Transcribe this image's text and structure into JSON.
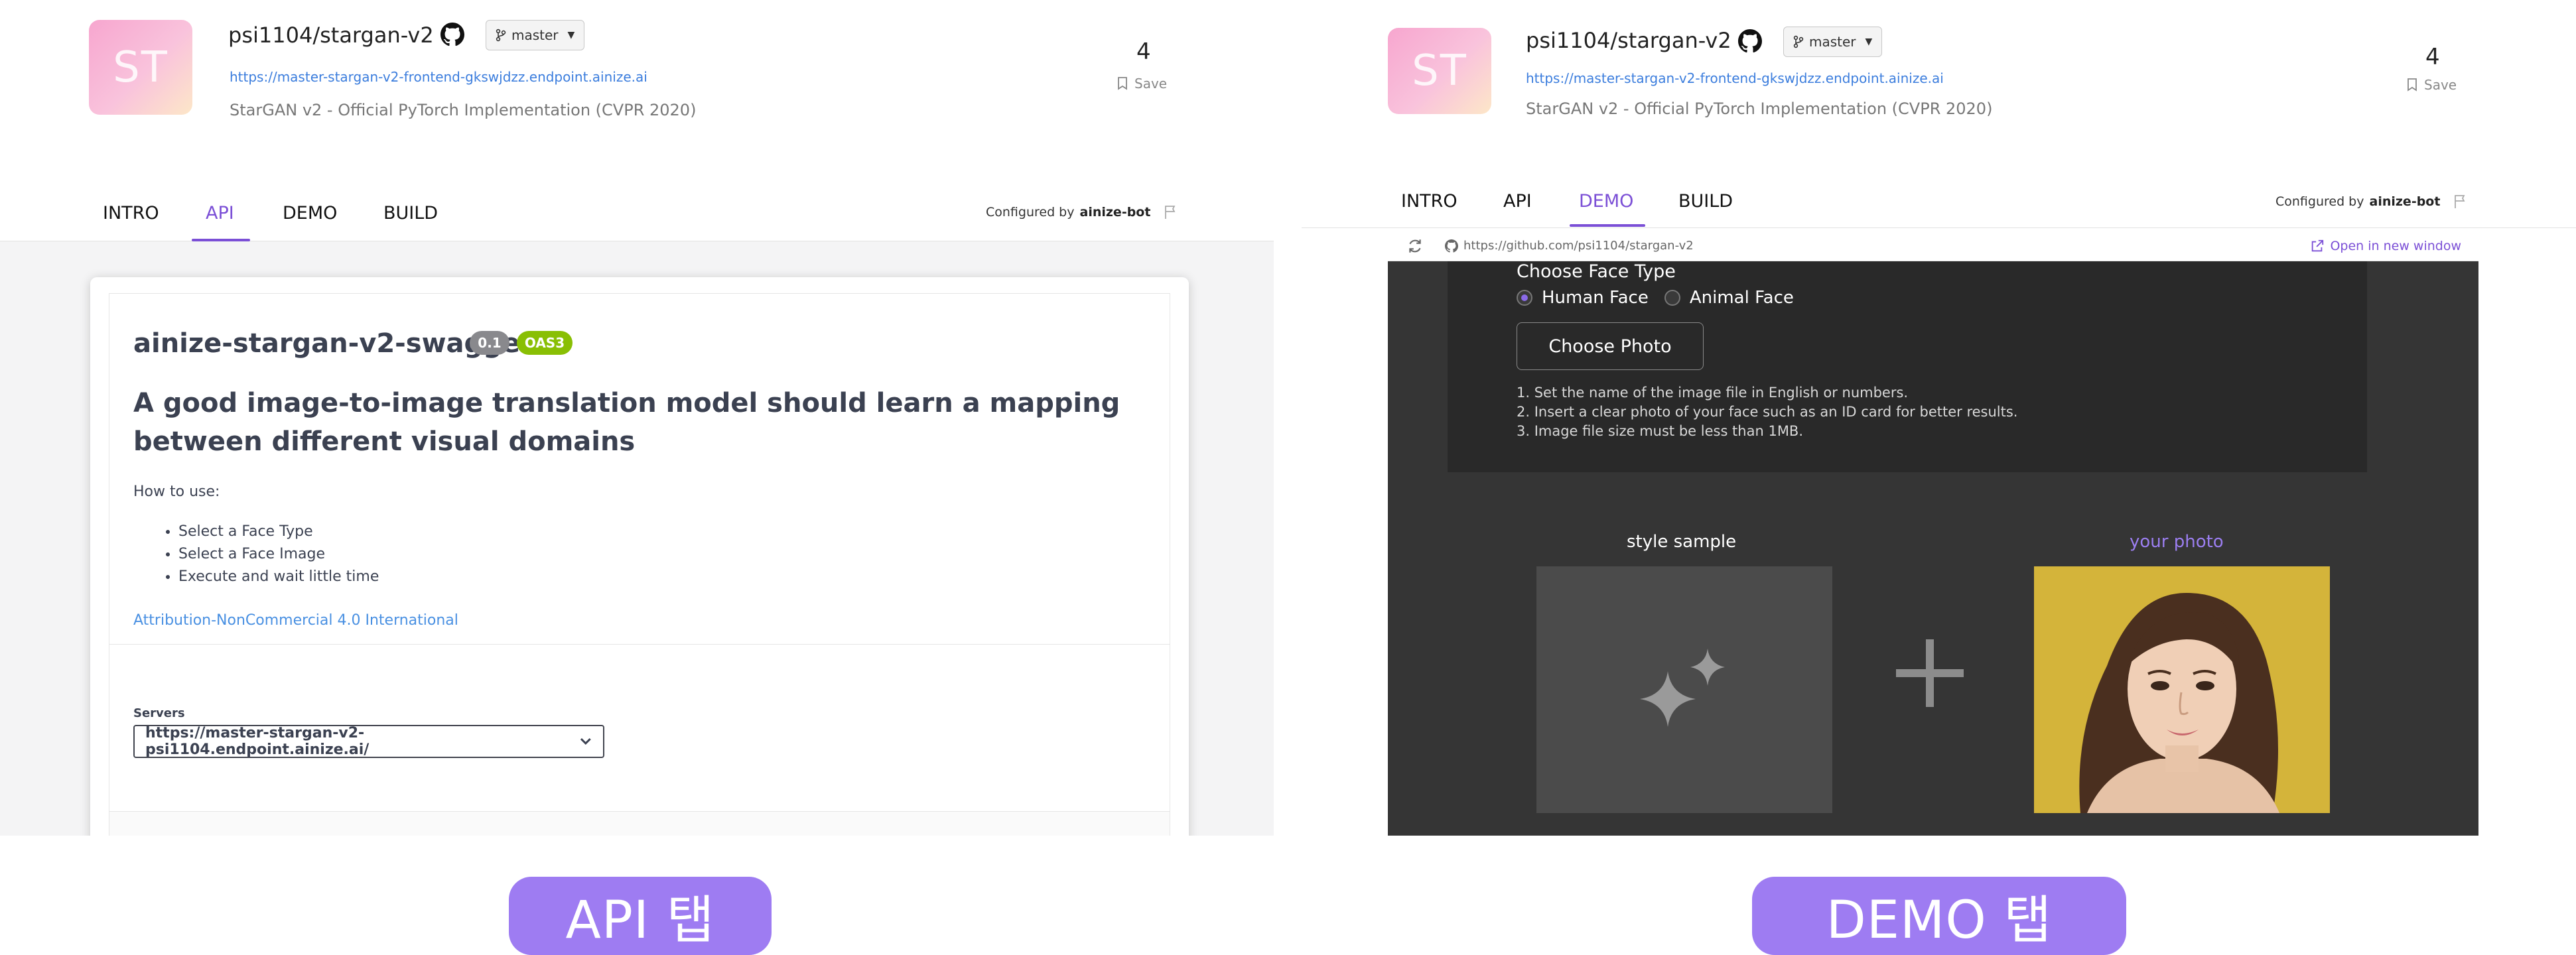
{
  "left": {
    "repo": {
      "logo_text": "ST",
      "name": "psi1104/stargan-v2",
      "branch": "master",
      "url": "https://master-stargan-v2-frontend-gkswjdzz.endpoint.ainize.ai",
      "description": "StarGAN v2 - Official PyTorch Implementation (CVPR 2020)",
      "count": "4",
      "save_label": "Save"
    },
    "tabs": [
      "INTRO",
      "API",
      "DEMO",
      "BUILD"
    ],
    "active_tab": "API",
    "configured_prefix": "Configured by",
    "configured_user": "ainize-bot",
    "swagger": {
      "title": "ainize-stargan-v2-swagger",
      "version_badge": "0.1",
      "oas_badge": "OAS3",
      "headline": "A good image-to-image translation model should learn a mapping between different visual domains",
      "how_to": "How to use:",
      "steps": [
        "Select a Face Type",
        "Select a Face Image",
        "Execute and wait little time"
      ],
      "license_link": "Attribution-NonCommercial 4.0 International",
      "servers_label": "Servers",
      "server_value": "https://master-stargan-v2-psi1104.endpoint.ainize.ai/"
    }
  },
  "right": {
    "repo": {
      "logo_text": "ST",
      "name": "psi1104/stargan-v2",
      "branch": "master",
      "url": "https://master-stargan-v2-frontend-gkswjdzz.endpoint.ainize.ai",
      "description": "StarGAN v2 - Official PyTorch Implementation (CVPR 2020)",
      "count": "4",
      "save_label": "Save"
    },
    "tabs": [
      "INTRO",
      "API",
      "DEMO",
      "BUILD"
    ],
    "active_tab": "DEMO",
    "configured_prefix": "Configured by",
    "configured_user": "ainize-bot",
    "frame": {
      "url": "https://github.com/psi1104/stargan-v2",
      "open_label": "Open in new window"
    },
    "demo": {
      "heading": "Choose Face Type",
      "options": [
        "Human Face",
        "Animal Face"
      ],
      "selected_option": "Human Face",
      "choose_button": "Choose Photo",
      "rules": [
        "1. Set the name of the image file in English or numbers.",
        "2. Insert a clear photo of your face such as an ID card for better results.",
        "3. Image file size must be less than 1MB."
      ],
      "style_label": "style sample",
      "photo_label": "your photo"
    }
  },
  "captions": {
    "left": "API 탭",
    "right": "DEMO 탭"
  },
  "colors": {
    "accent": "#7b4fd6",
    "pill": "#9e7cf2",
    "link": "#3b7ddd",
    "badge_version": "#89898d",
    "badge_oas": "#89bf04",
    "demo_bg": "#353535"
  }
}
